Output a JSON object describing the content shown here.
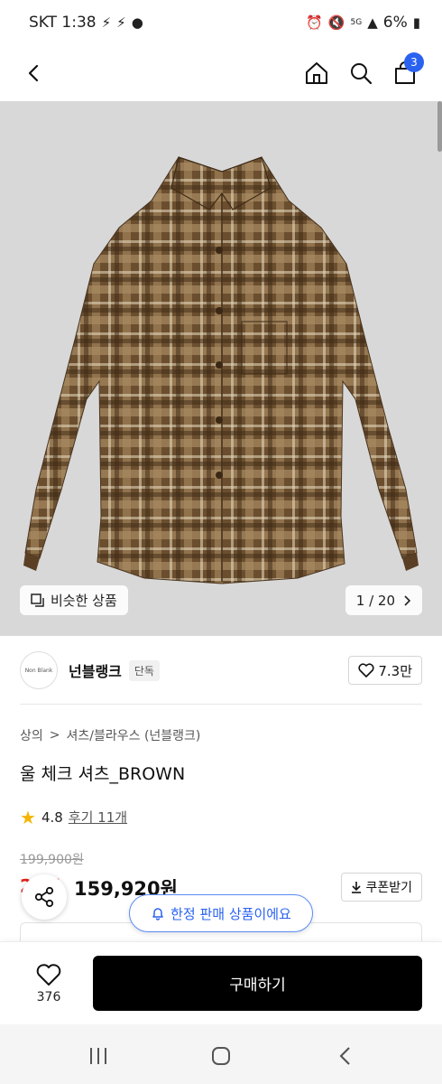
{
  "status_bar": {
    "carrier_time": "SKT 1:38",
    "battery": "6%",
    "network": "5G"
  },
  "nav": {
    "cart_count": "3"
  },
  "gallery": {
    "similar_label": "비슷한 상품",
    "page_indicator": "1 / 20"
  },
  "brand": {
    "logo_text": "Non Blank",
    "name": "넌블랭크",
    "badge": "단독",
    "likes": "7.3만"
  },
  "product": {
    "breadcrumb": [
      "상의",
      "셔츠/블라우스 (넌블랭크)"
    ],
    "title": "울 체크 셔츠_BROWN",
    "rating": "4.8",
    "reviews": "후기 11개",
    "original_price": "199,900원",
    "discount": "20%",
    "sale_price": "159,920원",
    "coupon_label": "쿠폰받기"
  },
  "floating": {
    "limited_label": "한정 판매 상품이에요"
  },
  "bottom_bar": {
    "wish_count": "376",
    "buy_label": "구매하기"
  },
  "colors": {
    "accent_blue": "#2a62f0",
    "discount_red": "#e0231b",
    "star_yellow": "#f5b400",
    "shirt_brown": "#6b4e2e"
  }
}
